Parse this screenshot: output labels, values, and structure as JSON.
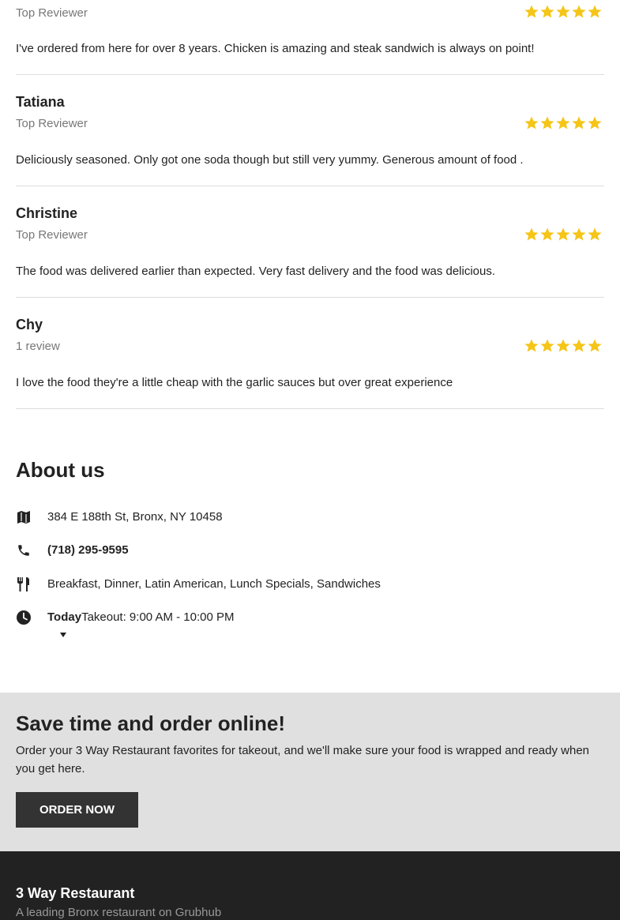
{
  "colors": {
    "star": "#f5c518",
    "promo_bg": "#e0e0e0",
    "footer_bg": "#222222",
    "button_bg": "#333333"
  },
  "reviews": [
    {
      "name": "",
      "subtitle": "Top Reviewer",
      "rating": 5,
      "text": "I've ordered from here for over 8 years. Chicken is amazing and steak sandwich is always on point!"
    },
    {
      "name": "Tatiana",
      "subtitle": "Top Reviewer",
      "rating": 5,
      "text": "Deliciously seasoned. Only got one soda though but still very yummy. Generous amount of food ."
    },
    {
      "name": "Christine",
      "subtitle": "Top Reviewer",
      "rating": 5,
      "text": "The food was delivered earlier than expected. Very fast delivery and the food was delicious."
    },
    {
      "name": "Chy",
      "subtitle": "1 review",
      "rating": 5,
      "text": "I love the food they're a little cheap with the garlic sauces but over great experience"
    }
  ],
  "about": {
    "title": "About us",
    "address": "384 E 188th St, Bronx, NY 10458",
    "phone": "(718) 295-9595",
    "cuisines": "Breakfast, Dinner, Latin American, Lunch Specials, Sandwiches",
    "hours_day": "Today",
    "hours_text": "Takeout: 9:00 AM - 10:00 PM",
    "icons": [
      "map-icon",
      "phone-icon",
      "utensils-icon",
      "clock-icon",
      "caret-down-icon"
    ]
  },
  "promo": {
    "title": "Save time and order online!",
    "text": "Order your 3 Way Restaurant favorites for takeout, and we'll make sure your food is wrapped and ready when you get here.",
    "button_label": "ORDER NOW"
  },
  "footer": {
    "title": "3 Way Restaurant",
    "subtitle": "A leading Bronx restaurant on Grubhub"
  }
}
